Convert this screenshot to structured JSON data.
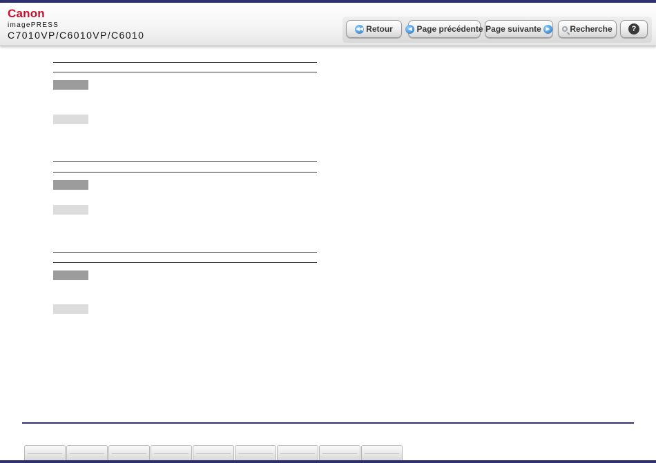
{
  "header": {
    "brand": "Canon",
    "product": "imagePRESS",
    "model": "C7010VP/C6010VP/C6010"
  },
  "toolbar": {
    "back_label": "Retour",
    "prev_label": "Page précédente",
    "next_label": "Page suivante",
    "search_label": "Recherche",
    "help_label": "?"
  },
  "icons": {
    "back": "rewind-circle-icon",
    "prev": "left-arrow-circle-icon",
    "next": "right-arrow-circle-icon",
    "search": "magnifier-icon",
    "help": "question-mark-icon"
  },
  "colors": {
    "brand": "#c8102e",
    "frame": "#2d2f6e",
    "swatch_dark": "#9c9c9c",
    "swatch_light": "#dcdcdc"
  },
  "bottom_tabs_count": 9
}
